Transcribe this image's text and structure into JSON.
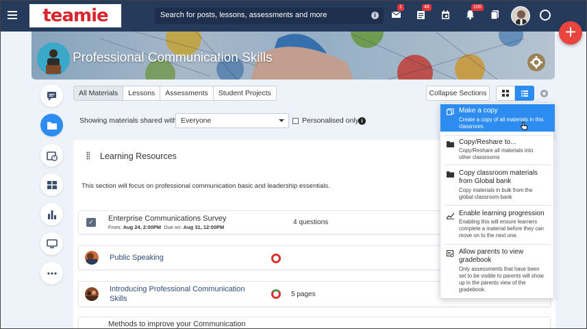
{
  "topbar": {
    "logo_text": "teamie",
    "search_placeholder": "Search for posts, lessons, assessments and more",
    "badges": {
      "mail": "1",
      "posts": "48",
      "notifications": "100"
    }
  },
  "banner": {
    "title": "Professional Communication Skills"
  },
  "tabs": [
    "All Materials",
    "Lessons",
    "Assessments",
    "Student Projects"
  ],
  "toolbar": {
    "collapse_label": "Collapse Sections"
  },
  "filter": {
    "label": "Showing materials shared with",
    "selected": "Everyone",
    "personalised_label": "Personalised only"
  },
  "section": {
    "title": "Learning Resources",
    "description": "This section will focus on professional communication basic and leadership essentials."
  },
  "items": [
    {
      "title": "Enterprise Communications Survey",
      "from_label": "From:",
      "from": "Aug 24, 2:00PM",
      "due_label": "Due on:",
      "due": "Aug 31, 12:00PM",
      "count": "4 questions"
    },
    {
      "title": "Public Speaking"
    },
    {
      "title_line1": "Introducing Professional Communication",
      "title_line2": "Skills",
      "count": "5 pages"
    },
    {
      "title": "Methods to improve your Communication"
    }
  ],
  "menu": [
    {
      "title": "Make a copy",
      "desc": [
        "Create a copy of all materials in this",
        "classroom."
      ],
      "icon": "copy-icon"
    },
    {
      "title": "Copy/Reshare to...",
      "desc": [
        "Copy/Reshare all materials into",
        "other classrooms"
      ],
      "icon": "folder-icon"
    },
    {
      "title_lines": [
        "Copy classroom materials",
        "from Global bank"
      ],
      "desc": [
        "Copy materials in bulk from the",
        "global classroom bank"
      ],
      "icon": "folder-icon"
    },
    {
      "title": "Enable learning progression",
      "desc": [
        "Enabling this will ensure learners",
        "complete a material before they can",
        "move on to the next one."
      ],
      "icon": "progression-icon"
    },
    {
      "title_lines": [
        "Allow parents to view",
        "gradebook"
      ],
      "desc": [
        "Only assessments that have been",
        "set to be visible to parents will show",
        "up in the parents view of the",
        "gradebook."
      ],
      "icon": "gradebook-icon"
    }
  ],
  "colors": {
    "topbar": "#263a5b",
    "accent": "#2d8cf0",
    "brand_red": "#d8262e",
    "fab": "#e8453e"
  }
}
